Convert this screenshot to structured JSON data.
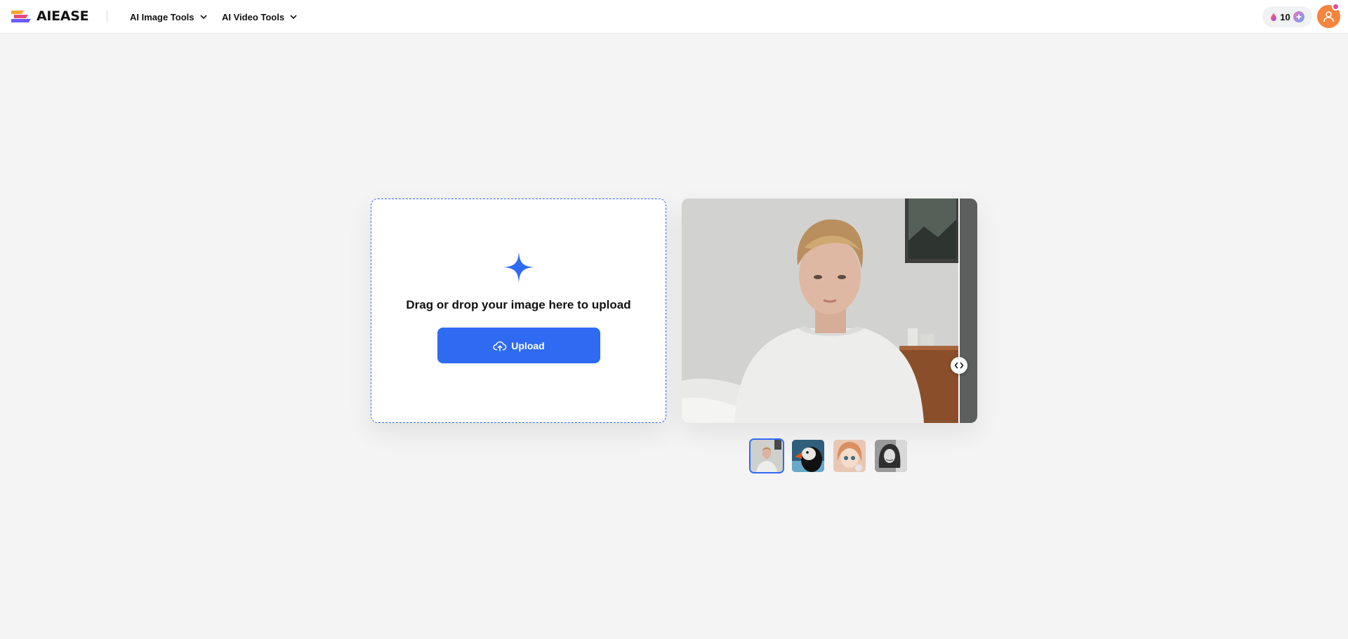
{
  "brand": {
    "name": "AIEASE"
  },
  "nav": {
    "items": [
      {
        "label": "AI Image Tools"
      },
      {
        "label": "AI Video Tools"
      }
    ]
  },
  "account": {
    "credits": "10"
  },
  "upload": {
    "prompt": "Drag or drop your image here to upload",
    "button_label": "Upload"
  },
  "colors": {
    "accent": "#2f6bf2",
    "avatar": "#f5843d",
    "background": "#f4f4f4"
  },
  "icons": [
    "logo-icon",
    "chevron-down-icon",
    "credit-drop-icon",
    "add-credits-icon",
    "user-icon",
    "sparkle-icon",
    "cloud-upload-icon",
    "compare-arrows-icon"
  ],
  "samples": {
    "selected_index": 0,
    "items": [
      "portrait",
      "puffin",
      "anime-girl",
      "bw-woman"
    ]
  }
}
